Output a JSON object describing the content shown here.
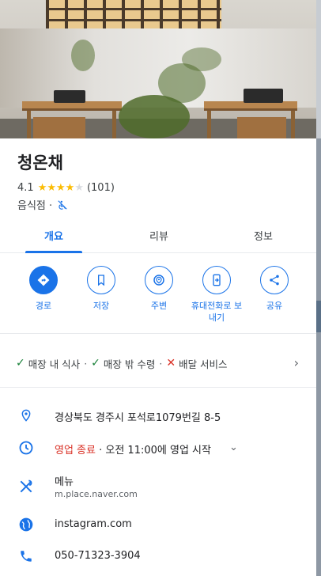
{
  "place": {
    "name": "청온채",
    "rating": "4.1",
    "stars": "★★★★",
    "star_off": "★",
    "review_count": "(101)",
    "category": "음식점 ·"
  },
  "tabs": [
    {
      "label": "개요"
    },
    {
      "label": "리뷰"
    },
    {
      "label": "정보"
    }
  ],
  "actions": [
    {
      "label": "경로",
      "icon": "directions-icon"
    },
    {
      "label": "저장",
      "icon": "bookmark-icon"
    },
    {
      "label": "주변",
      "icon": "nearby-icon"
    },
    {
      "label": "휴대전화로 보내기",
      "label_line1": "휴대전화로 보",
      "label_line2": "내기",
      "icon": "send-to-phone-icon"
    },
    {
      "label": "공유",
      "icon": "share-icon"
    }
  ],
  "services": {
    "dine_in": "매장 내 식사",
    "takeout": "매장 밖 수령",
    "delivery": "배달 서비스",
    "sep": "·"
  },
  "info": {
    "address": "경상북도 경주시 포석로1079번길 8-5",
    "hours_status": "영업 종료",
    "hours_detail": " · 오전 11:00에 영업 시작",
    "menu_label": "메뉴",
    "menu_url": "m.place.naver.com",
    "website": "instagram.com",
    "phone": "050-71323-3904"
  },
  "colors": {
    "accent": "#1a73e8",
    "star": "#fbbc04",
    "closed": "#d93025",
    "available": "#188038"
  }
}
